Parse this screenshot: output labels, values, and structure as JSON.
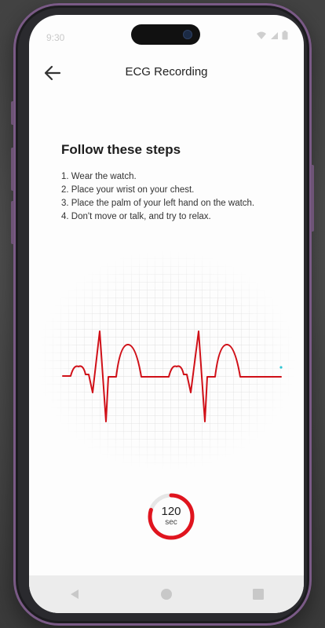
{
  "status_bar": {
    "time": "9:30"
  },
  "header": {
    "title": "ECG Recording",
    "back_icon": "arrow-left-icon"
  },
  "instructions": {
    "heading": "Follow these steps",
    "steps": [
      "1. Wear the watch.",
      "2. Place your wrist on your chest.",
      "3. Place the palm of your left hand on the watch.",
      "4. Don't move or talk, and try to relax."
    ]
  },
  "timer": {
    "value": "120",
    "unit": "sec",
    "progress": 0.8
  },
  "colors": {
    "accent": "#e0141e",
    "waveform": "#d01018",
    "marker": "#2ec5d3"
  },
  "nav": {
    "back": "triangle-back-icon",
    "home": "circle-home-icon",
    "recents": "square-recents-icon"
  }
}
